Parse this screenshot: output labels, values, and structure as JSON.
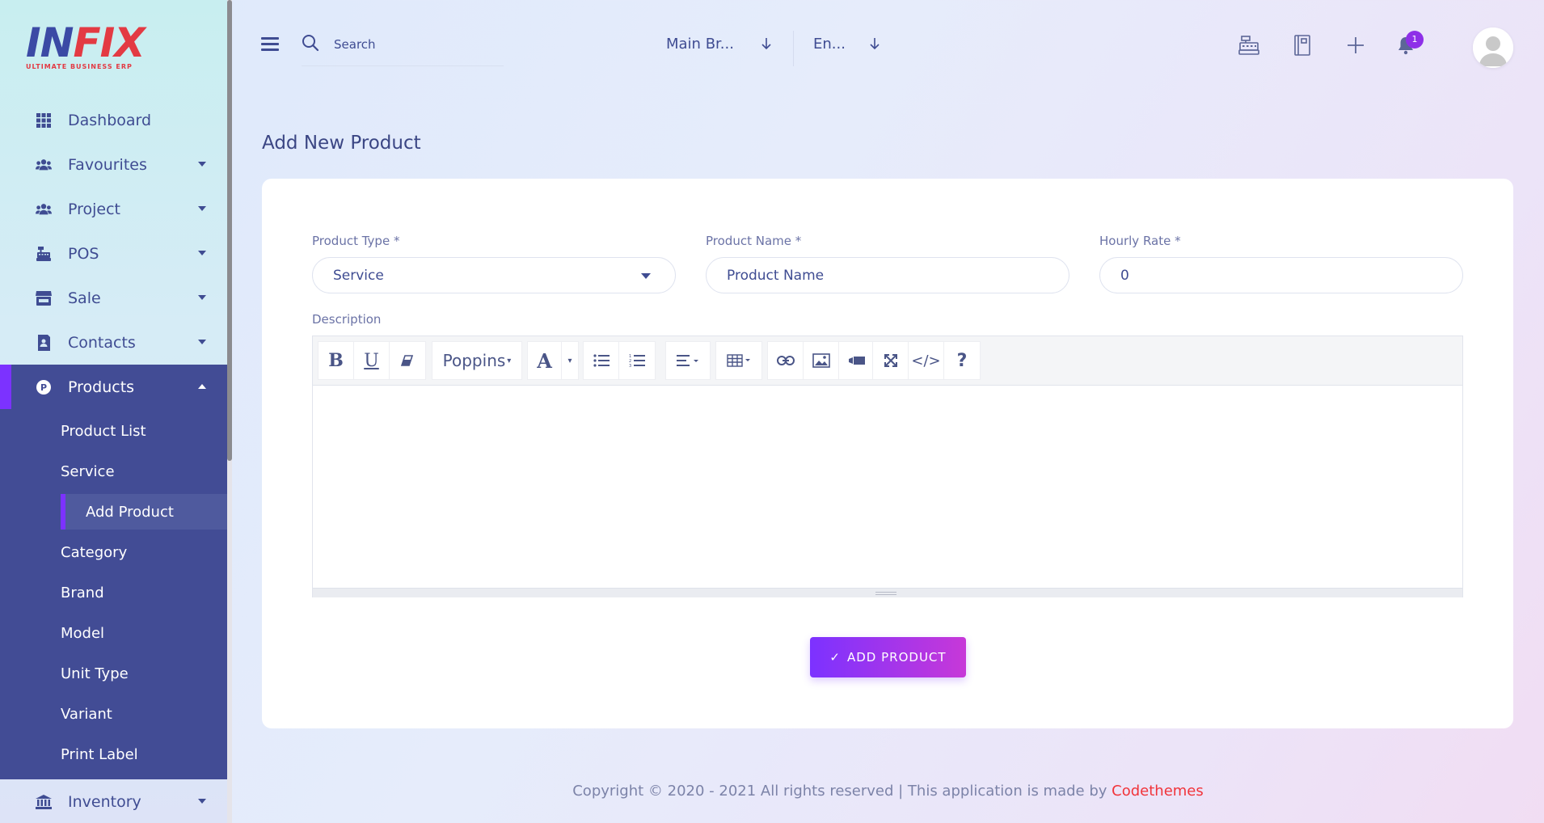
{
  "brand": {
    "logo_text_1": "IN",
    "logo_text_2": "FIX",
    "tagline": "ULTIMATE BUSINESS ERP"
  },
  "sidebar": {
    "items": [
      {
        "label": "Dashboard",
        "icon": "grid-icon",
        "has_caret": false
      },
      {
        "label": "Favourites",
        "icon": "users-icon",
        "has_caret": true
      },
      {
        "label": "Project",
        "icon": "users-icon",
        "has_caret": true
      },
      {
        "label": "POS",
        "icon": "cash-register-icon",
        "has_caret": true
      },
      {
        "label": "Sale",
        "icon": "store-icon",
        "has_caret": true
      },
      {
        "label": "Contacts",
        "icon": "contact-book-icon",
        "has_caret": true
      },
      {
        "label": "Products",
        "icon": "product-p-icon",
        "has_caret": true,
        "active": true
      },
      {
        "label": "Inventory",
        "icon": "bank-icon",
        "has_caret": true
      }
    ],
    "products_submenu": [
      {
        "label": "Product List"
      },
      {
        "label": "Service"
      },
      {
        "label": "Add Product",
        "active": true
      },
      {
        "label": "Category"
      },
      {
        "label": "Brand"
      },
      {
        "label": "Model"
      },
      {
        "label": "Unit Type"
      },
      {
        "label": "Variant"
      },
      {
        "label": "Print Label"
      }
    ]
  },
  "header": {
    "search_placeholder": "Search",
    "branch_select": "Main Br...",
    "language_select": "En...",
    "notification_count": "1"
  },
  "page": {
    "title": "Add New Product"
  },
  "form": {
    "product_type_label": "Product Type *",
    "product_type_value": "Service",
    "product_name_label": "Product Name *",
    "product_name_placeholder": "Product Name",
    "hourly_rate_label": "Hourly Rate *",
    "hourly_rate_value": "0",
    "description_label": "Description",
    "font_select": "Poppins",
    "submit_label": "ADD PRODUCT",
    "submit_check": "✓"
  },
  "footer": {
    "text": "Copyright © 2020 - 2021 All rights reserved | This application is made by ",
    "link": "Codethemes"
  },
  "colors": {
    "accent": "#7c32ff",
    "sidebar_active": "#424c95",
    "text": "#3f4c92",
    "link": "#f1343a"
  }
}
